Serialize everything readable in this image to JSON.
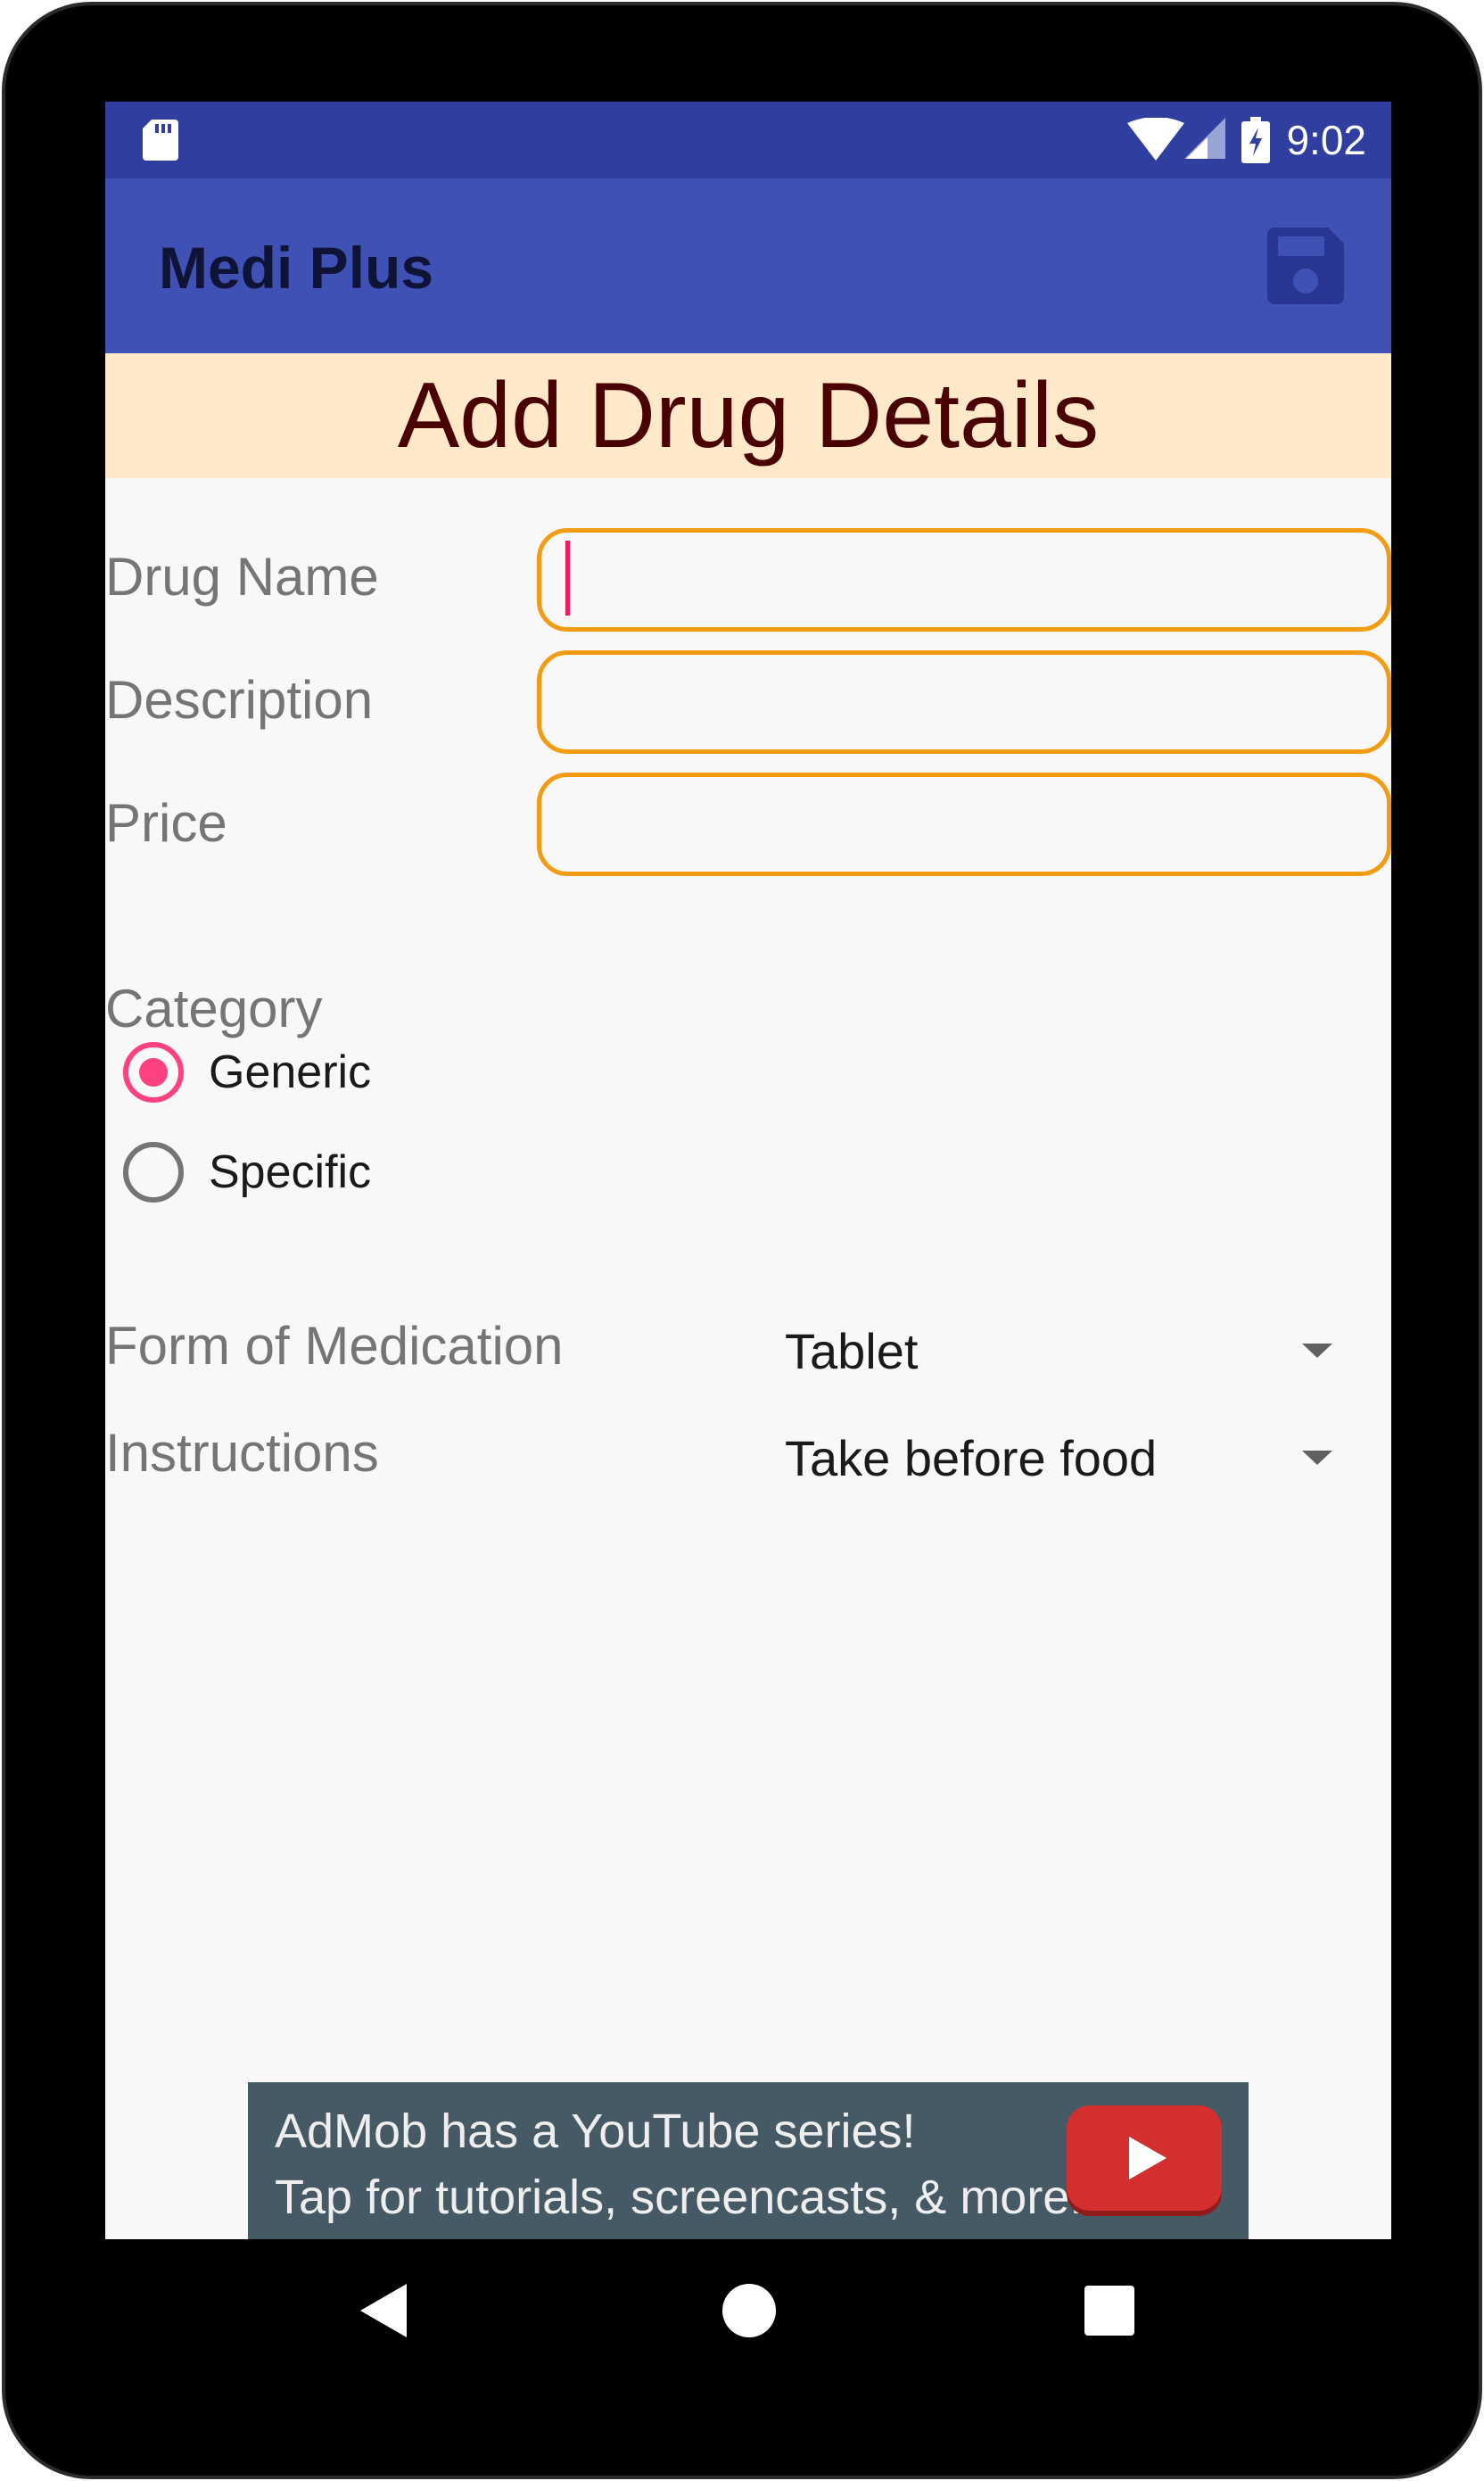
{
  "status_bar": {
    "time": "9:02",
    "icons": [
      "sd-card-icon",
      "wifi-icon",
      "cell-signal-icon",
      "battery-charging-icon"
    ]
  },
  "app_bar": {
    "title": "Medi Plus",
    "action_icon": "save-icon"
  },
  "header": {
    "title": "Add Drug Details"
  },
  "form": {
    "drug_name": {
      "label": "Drug Name",
      "value": ""
    },
    "description": {
      "label": "Description",
      "value": ""
    },
    "price": {
      "label": "Price",
      "value": ""
    },
    "category": {
      "label": "Category",
      "options": [
        {
          "label": "Generic",
          "checked": true
        },
        {
          "label": "Specific",
          "checked": false
        }
      ]
    },
    "form_of_medication": {
      "label": "Form of Medication",
      "selected": "Tablet"
    },
    "instructions": {
      "label": "Instructions",
      "selected": "Take before food"
    }
  },
  "ad": {
    "line1": "AdMob has a YouTube series!",
    "line2": "Tap for tutorials, screencasts, & more.",
    "icon": "youtube-play-icon"
  },
  "nav_bar": {
    "icons": [
      "back-icon",
      "home-icon",
      "recents-icon"
    ]
  },
  "colors": {
    "status_bar": "#303f9f",
    "app_bar": "#3f51b5",
    "header_band": "#ffe9c8",
    "field_border": "#f39c12",
    "accent": "#ff4081",
    "ad_background": "#455a64"
  }
}
